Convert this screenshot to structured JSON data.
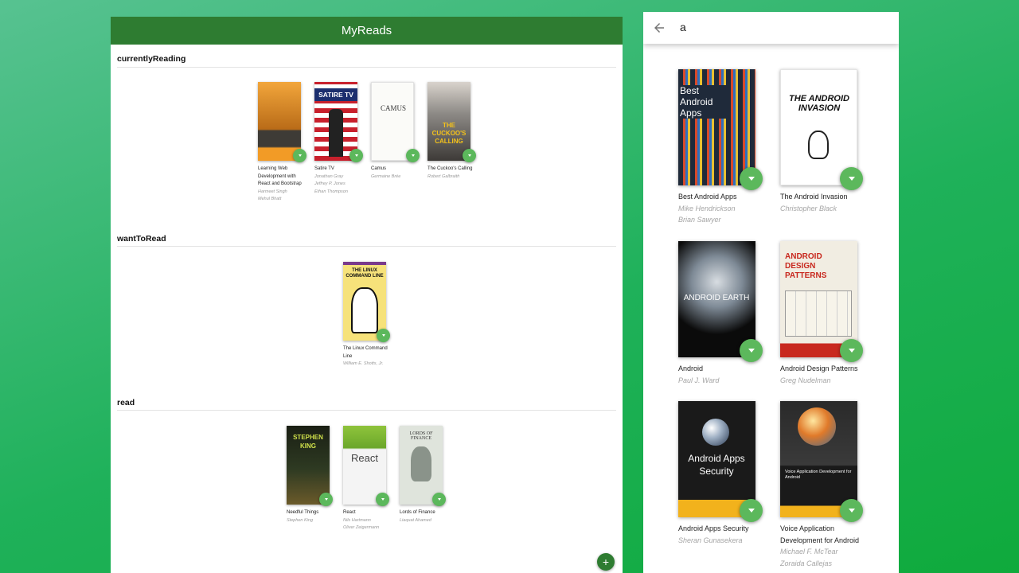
{
  "app": {
    "title": "MyReads",
    "add_label": "+"
  },
  "shelves": [
    {
      "title": "currentlyReading",
      "books": [
        {
          "title": "Learning Web Development with React and Bootstrap",
          "authors": [
            "Harmeet Singh",
            "Mehul Bhatt"
          ]
        },
        {
          "title": "Satire TV",
          "authors": [
            "Jonathan Gray",
            "Jeffrey P. Jones",
            "Ethan Thompson"
          ],
          "cover_text": "SATIRE TV"
        },
        {
          "title": "Camus",
          "authors": [
            "Germaine Brée"
          ],
          "cover_text": "CAMUS"
        },
        {
          "title": "The Cuckoo's Calling",
          "authors": [
            "Robert Galbraith"
          ],
          "cover_text": "THE CUCKOO'S CALLING"
        }
      ]
    },
    {
      "title": "wantToRead",
      "books": [
        {
          "title": "The Linux Command Line",
          "authors": [
            "William E. Shotts, Jr."
          ],
          "cover_text": "THE LINUX COMMAND LINE"
        }
      ]
    },
    {
      "title": "read",
      "books": [
        {
          "title": "Needful Things",
          "authors": [
            "Stephen King"
          ],
          "cover_text": "STEPHEN KING"
        },
        {
          "title": "React",
          "authors": [
            "Nils Hartmann",
            "Oliver Zeigermann"
          ],
          "cover_text": "React"
        },
        {
          "title": "Lords of Finance",
          "authors": [
            "Liaquat Ahamed"
          ],
          "cover_text": "LORDS OF FINANCE"
        }
      ]
    }
  ],
  "search": {
    "query": "a",
    "results": [
      {
        "title": "Best Android Apps",
        "authors": [
          "Mike Hendrickson",
          "Brian Sawyer"
        ],
        "cover_text": "Best Android Apps"
      },
      {
        "title": "The Android Invasion",
        "authors": [
          "Christopher Black"
        ],
        "cover_text": "THE ANDROID INVASION"
      },
      {
        "title": "Android",
        "authors": [
          "Paul J. Ward"
        ],
        "cover_text": "ANDROID EARTH"
      },
      {
        "title": "Android Design Patterns",
        "authors": [
          "Greg Nudelman"
        ],
        "cover_text": "ANDROID DESIGN PATTERNS"
      },
      {
        "title": "Android Apps Security",
        "authors": [
          "Sheran Gunasekera"
        ],
        "cover_text": "Android Apps Security"
      },
      {
        "title": "Voice Application Development for Android",
        "authors": [
          "Michael F. McTear",
          "Zoraida Callejas"
        ],
        "cover_text": "Voice Application Development for Android"
      }
    ]
  },
  "colors": {
    "header": "#2e7c31",
    "fab": "#5cb85c",
    "background": "#1fb15a"
  }
}
